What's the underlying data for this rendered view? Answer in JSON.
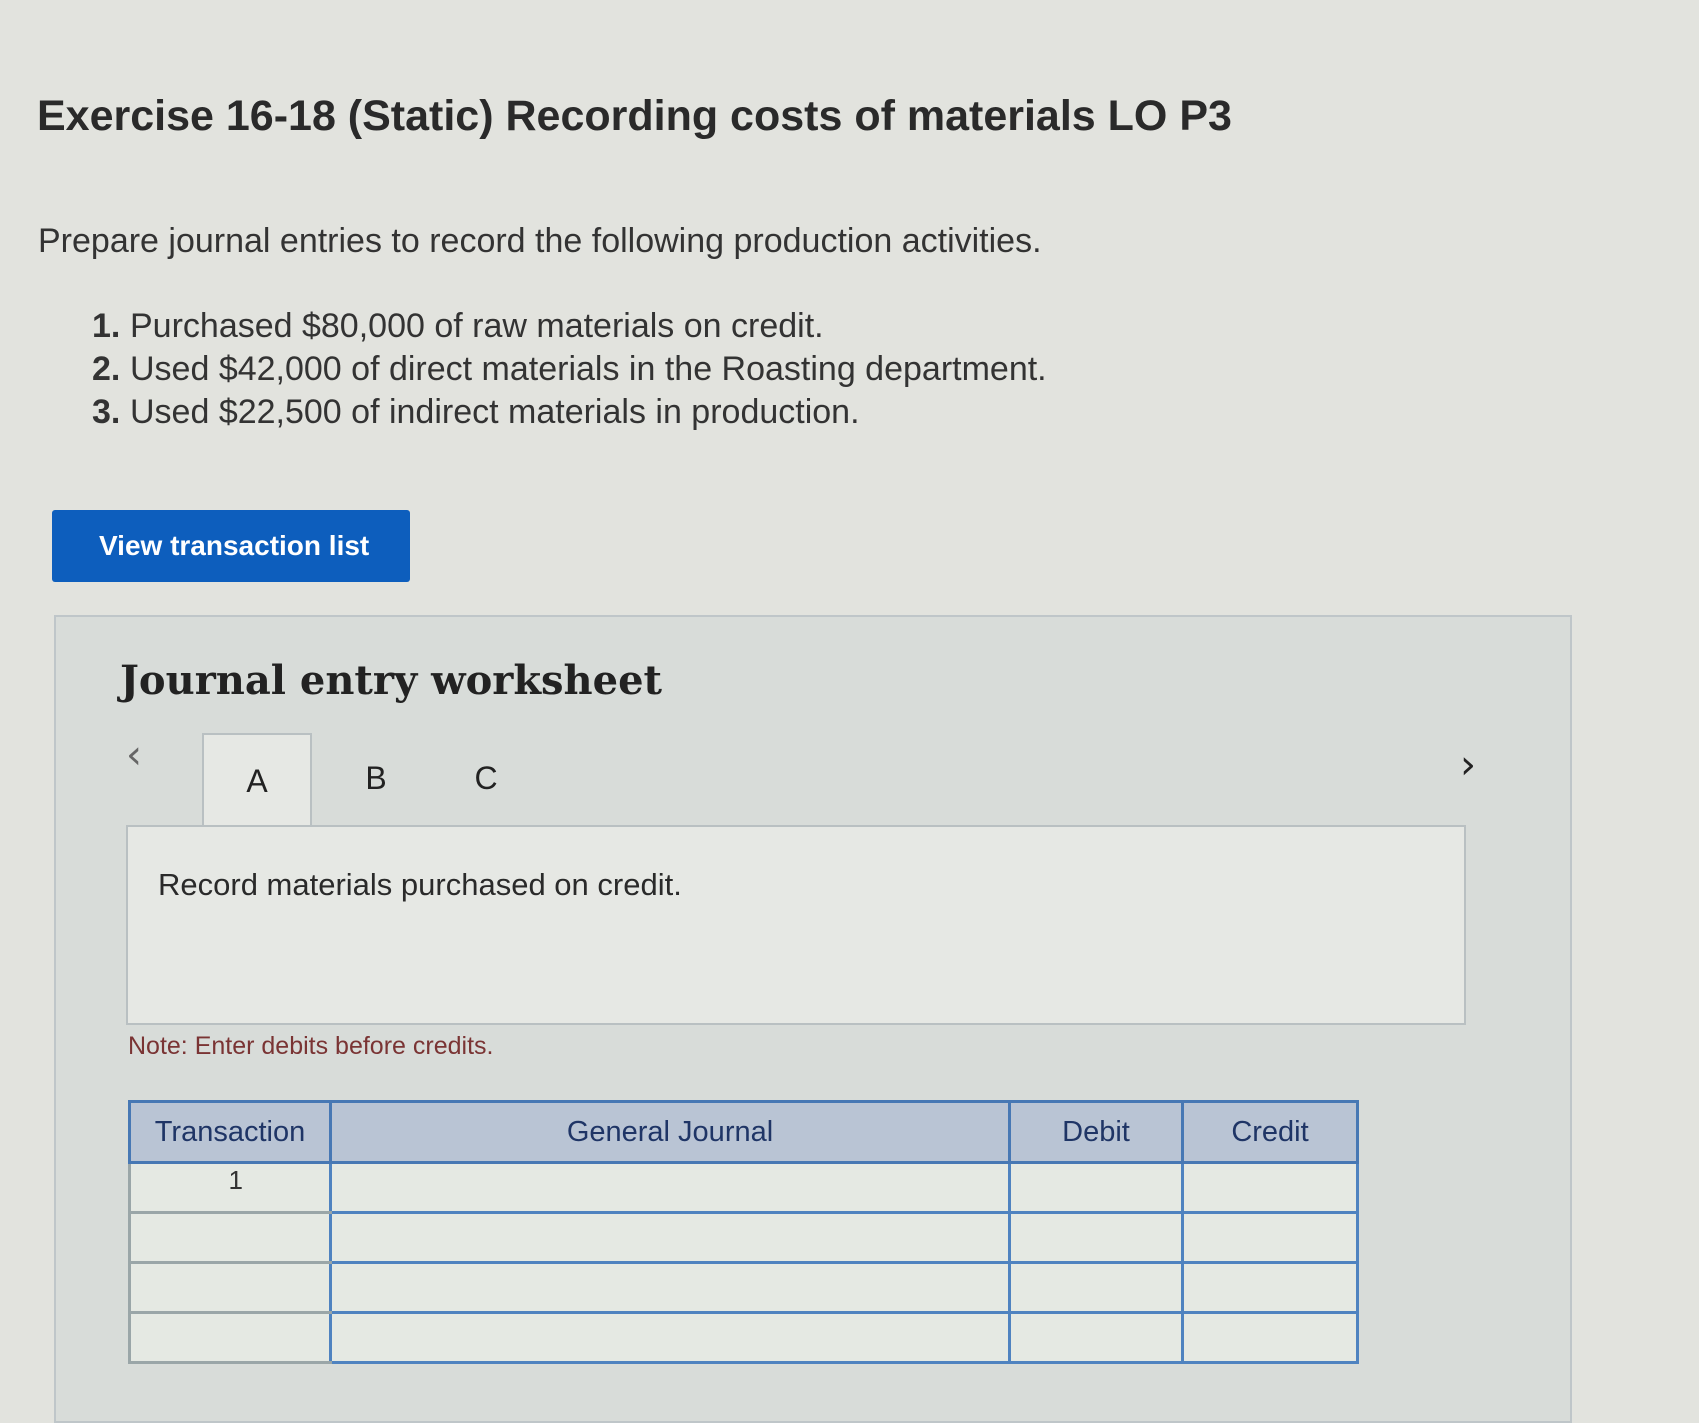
{
  "exercise": {
    "title": "Exercise 16-18 (Static) Recording costs of materials LO P3",
    "instructions": "Prepare journal entries to record the following production activities.",
    "activities": [
      {
        "num": "1.",
        "text": "Purchased $80,000 of raw materials on credit."
      },
      {
        "num": "2.",
        "text": "Used $42,000 of direct materials in the Roasting department."
      },
      {
        "num": "3.",
        "text": "Used $22,500 of indirect materials in production."
      }
    ]
  },
  "view_transactions_button": "View transaction list",
  "worksheet": {
    "title": "Journal entry worksheet",
    "prev_icon": "chevron-left-icon",
    "next_icon": "chevron-right-icon",
    "tabs": [
      {
        "label": "A",
        "active": true
      },
      {
        "label": "B",
        "active": false
      },
      {
        "label": "C",
        "active": false
      }
    ],
    "panel_text": "Record materials purchased on credit.",
    "note": "Note: Enter debits before credits.",
    "table": {
      "headers": {
        "transaction": "Transaction",
        "general_journal": "General Journal",
        "debit": "Debit",
        "credit": "Credit"
      },
      "rows": [
        {
          "transaction": "1",
          "general_journal": "",
          "debit": "",
          "credit": ""
        },
        {
          "transaction": "",
          "general_journal": "",
          "debit": "",
          "credit": ""
        },
        {
          "transaction": "",
          "general_journal": "",
          "debit": "",
          "credit": ""
        },
        {
          "transaction": "",
          "general_journal": "",
          "debit": "",
          "credit": ""
        }
      ]
    }
  },
  "colors": {
    "button_blue": "#0d5ebd",
    "table_border": "#4f83c0",
    "note_text": "#7a3434"
  }
}
